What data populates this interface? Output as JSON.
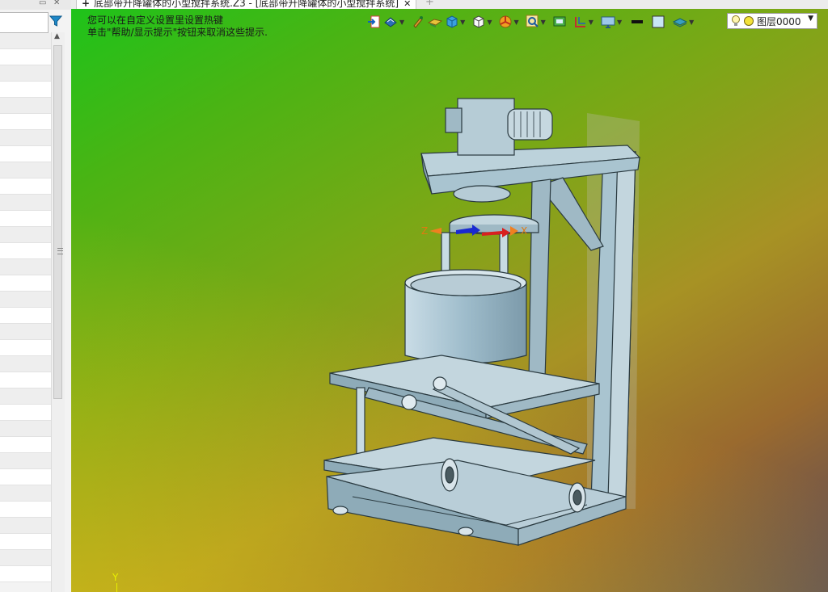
{
  "document_tab": {
    "title": "底部带升降罐体的小型搅拌系统.Z3 - [底部带升降罐体的小型搅拌系统]"
  },
  "viewport": {
    "hint_line1": "您可以在自定义设置里设置热键",
    "hint_line2": "单击\"帮助/显示提示\"按钮来取消这些提示.",
    "axis_x": "X",
    "axis_y": "Y",
    "axis_z": "Z"
  },
  "toolbar": {
    "layer_value": "图层0000",
    "icons": [
      "exit-sketch-icon",
      "render-mode-icon",
      "pen-icon",
      "face-icon",
      "cube-view-icon",
      "white-cube-icon",
      "color-wheel-icon",
      "zoom-icon",
      "screen-icon",
      "section-icon",
      "display-icon",
      "line-color-icon",
      "fill-color-icon",
      "layer-manager-icon",
      "bulb-icon"
    ]
  },
  "left_panel": {
    "search_placeholder": ""
  },
  "colors": {
    "viewport_green": "#1ec31a",
    "viewport_brown": "#9a6a2e",
    "model_body": "#a9c4d0",
    "model_edge": "#2a3a40"
  }
}
